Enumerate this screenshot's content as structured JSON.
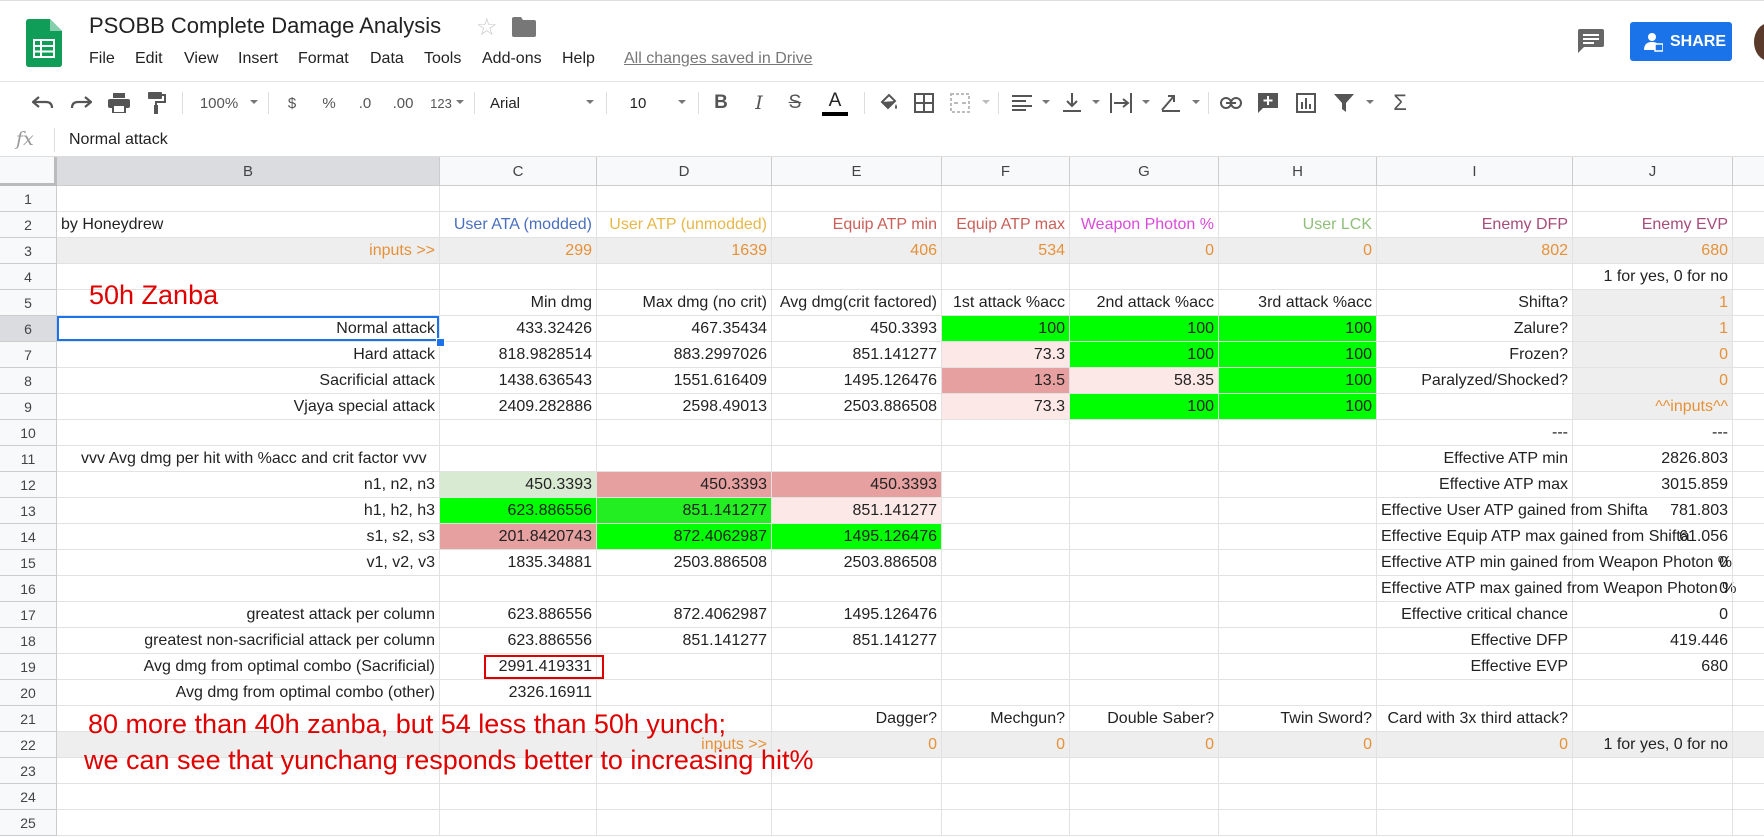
{
  "header": {
    "title": "PSOBB Complete Damage Analysis",
    "menu": [
      "File",
      "Edit",
      "View",
      "Insert",
      "Format",
      "Data",
      "Tools",
      "Add-ons",
      "Help"
    ],
    "saved_status": "All changes saved in Drive",
    "share_label": "SHARE"
  },
  "toolbar": {
    "zoom": "100%",
    "currency": "$",
    "percent": "%",
    "dec_less": ".0",
    "dec_more": ".00",
    "more_formats": "123",
    "font": "Arial",
    "font_size": "10",
    "bold": "B",
    "italic": "I",
    "strike": "S",
    "text_color": "A",
    "sum": "Σ"
  },
  "formula_bar": {
    "fx": "fx",
    "value": "Normal attack"
  },
  "columns": [
    "B",
    "C",
    "D",
    "E",
    "F",
    "G",
    "H",
    "I",
    "J"
  ],
  "rows": [
    "1",
    "2",
    "3",
    "4",
    "5",
    "6",
    "7",
    "8",
    "9",
    "10",
    "11",
    "12",
    "13",
    "14",
    "15",
    "16",
    "17",
    "18",
    "19",
    "20",
    "21",
    "22",
    "23",
    "24",
    "25"
  ],
  "cells": {
    "r2": {
      "B": "by Honeydrew",
      "C": "User ATA (modded)",
      "D": "User ATP (unmodded)",
      "E": "Equip ATP min",
      "F": "Equip ATP max",
      "G": "Weapon Photon %",
      "H": "User LCK",
      "I": "Enemy DFP",
      "J": "Enemy EVP"
    },
    "r3": {
      "B": "inputs >>",
      "C": "299",
      "D": "1639",
      "E": "406",
      "F": "534",
      "G": "0",
      "H": "0",
      "I": "802",
      "J": "680"
    },
    "r4": {
      "J": "1 for yes, 0 for no"
    },
    "r5": {
      "C": "Min dmg",
      "D": "Max dmg (no crit)",
      "E": "Avg dmg(crit factored)",
      "F": "1st attack %acc",
      "G": "2nd attack %acc",
      "H": "3rd attack %acc",
      "I": "Shifta?",
      "J": "1"
    },
    "r6": {
      "B": "Normal attack",
      "C": "433.32426",
      "D": "467.35434",
      "E": "450.3393",
      "F": "100",
      "G": "100",
      "H": "100",
      "I": "Zalure?",
      "J": "1"
    },
    "r7": {
      "B": "Hard attack",
      "C": "818.9828514",
      "D": "883.2997026",
      "E": "851.141277",
      "F": "73.3",
      "G": "100",
      "H": "100",
      "I": "Frozen?",
      "J": "0"
    },
    "r8": {
      "B": "Sacrificial attack",
      "C": "1438.636543",
      "D": "1551.616409",
      "E": "1495.126476",
      "F": "13.5",
      "G": "58.35",
      "H": "100",
      "I": "Paralyzed/Shocked?",
      "J": "0"
    },
    "r9": {
      "B": "Vjaya special attack",
      "C": "2409.282886",
      "D": "2598.49013",
      "E": "2503.886508",
      "F": "73.3",
      "G": "100",
      "H": "100",
      "J": "^^inputs^^"
    },
    "r10": {
      "I": "---",
      "J": "---"
    },
    "r11": {
      "B": "vvv Avg dmg per hit with %acc and crit factor vvv",
      "I": "Effective ATP min",
      "J": "2826.803"
    },
    "r12": {
      "B": "n1, n2, n3",
      "C": "450.3393",
      "D": "450.3393",
      "E": "450.3393",
      "I": "Effective ATP max",
      "J": "3015.859"
    },
    "r13": {
      "B": "h1, h2, h3",
      "C": "623.886556",
      "D": "851.141277",
      "E": "851.141277",
      "I": "Effective User ATP gained from Shifta",
      "J": "781.803"
    },
    "r14": {
      "B": "s1, s2, s3",
      "C": "201.8420743",
      "D": "872.4062987",
      "E": "1495.126476",
      "I": "Effective Equip ATP max gained from Shifta",
      "J": "61.056"
    },
    "r15": {
      "B": "v1, v2, v3",
      "C": "1835.34881",
      "D": "2503.886508",
      "E": "2503.886508",
      "I": "Effective ATP min gained from Weapon Photon %",
      "J": "0"
    },
    "r16": {
      "I": "Effective ATP max gained from Weapon Photon %",
      "J": "0"
    },
    "r17": {
      "B": "greatest attack per column",
      "C": "623.886556",
      "D": "872.4062987",
      "E": "1495.126476",
      "I": "Effective critical chance",
      "J": "0"
    },
    "r18": {
      "B": "greatest non-sacrificial attack per column",
      "C": "623.886556",
      "D": "851.141277",
      "E": "851.141277",
      "I": "Effective DFP",
      "J": "419.446"
    },
    "r19": {
      "B": "Avg dmg from optimal combo (Sacrificial)",
      "C": "2991.419331",
      "I": "Effective EVP",
      "J": "680"
    },
    "r20": {
      "B": "Avg dmg from optimal combo (other)",
      "C": "2326.16911"
    },
    "r21": {
      "E": "Dagger?",
      "F": "Mechgun?",
      "G": "Double Saber?",
      "H": "Twin Sword?",
      "I": "Card with 3x third attack?"
    },
    "r22": {
      "D": "inputs >>",
      "E": "0",
      "F": "0",
      "G": "0",
      "H": "0",
      "I": "0",
      "J": "1 for yes, 0 for no"
    }
  },
  "annotations": {
    "weapon": "50h Zanba",
    "note_line1": "80 more than 40h zanba, but 54 less than 50h yunch;",
    "note_line2": "we can see that yunchang responds better to increasing hit%"
  },
  "colors": {
    "green": "#00ff00",
    "light_green": "#d9ead3",
    "red_heat": "#e6a0a0",
    "pink": "#f4cccc",
    "light_pink": "#fce8e6",
    "orange_text": "#e69138",
    "blue_text": "#4a6fbf",
    "gold_text": "#e6b84a",
    "salmon_text": "#c9605a",
    "magenta_text": "#d94bd9",
    "sage_text": "#8fbf7a",
    "plum_text": "#a64d79",
    "annotation_red": "#e00000",
    "share_blue": "#1a73e8"
  }
}
